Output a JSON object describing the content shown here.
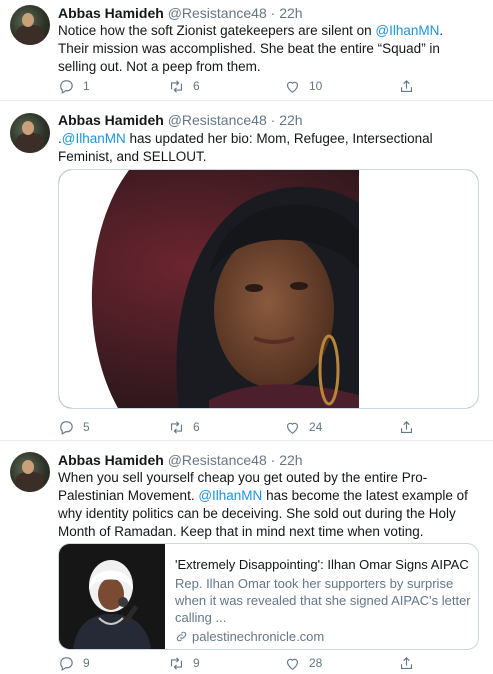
{
  "tweets": [
    {
      "name": "Abbas Hamideh",
      "handle": "@Resistance48",
      "time": "22h",
      "text_before": "Notice how the soft Zionist gatekeepers are silent on ",
      "mention": "@IlhanMN",
      "text_after": ". Their mission was accomplished. She beat the entire “Squad” in selling out. Not a peep from them.",
      "replies": "1",
      "retweets": "6",
      "likes": "10"
    },
    {
      "name": "Abbas Hamideh",
      "handle": "@Resistance48",
      "time": "22h",
      "text_before": ".",
      "mention": "@IlhanMN",
      "text_after": " has updated her bio: Mom, Refugee, Intersectional Feminist, and SELLOUT.",
      "replies": "5",
      "retweets": "6",
      "likes": "24"
    },
    {
      "name": "Abbas Hamideh",
      "handle": "@Resistance48",
      "time": "22h",
      "text_before": "When you sell yourself cheap you get outed by the entire Pro-Palestinian Movement. ",
      "mention": "@IlhanMN",
      "text_after": " has become the latest example of why identity politics can be deceiving. She sold out during the Holy Month of Ramadan. Keep that in mind next time when voting.",
      "card": {
        "title": "'Extremely Disappointing': Ilhan Omar Signs AIPAC Le...",
        "description": "Rep. Ilhan Omar took her supporters by surprise when it was revealed that she signed AIPAC's letter calling ...",
        "domain": "palestinechronicle.com"
      },
      "replies": "9",
      "retweets": "9",
      "likes": "28"
    }
  ],
  "icons": [
    "reply-icon",
    "retweet-icon",
    "like-icon",
    "share-icon",
    "link-icon"
  ],
  "colors": {
    "mention": "#1b95e0",
    "muted": "#657786",
    "border": "#e6ecf0"
  }
}
